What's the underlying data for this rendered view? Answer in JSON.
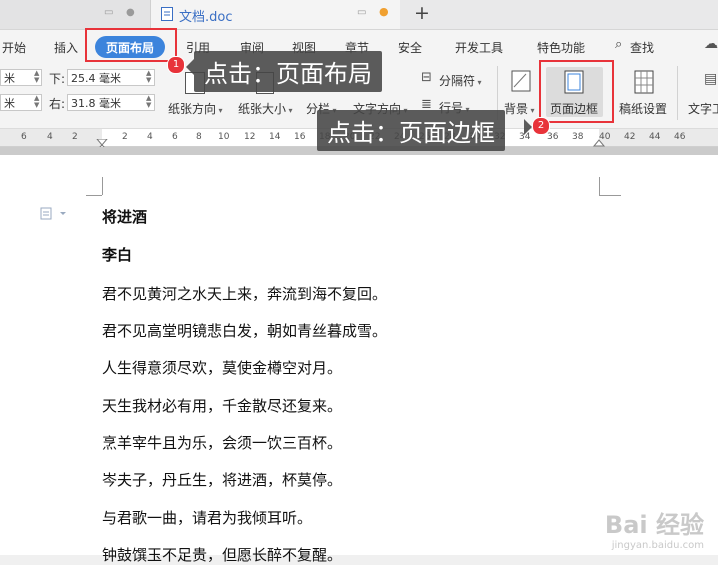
{
  "tabs": {
    "doc_title": "文档.doc",
    "new_tab": "+"
  },
  "menu": {
    "items": [
      "开始",
      "插入",
      "页面布局",
      "引用",
      "审阅",
      "视图",
      "章节",
      "安全",
      "开发工具",
      "特色功能"
    ],
    "search": "查找"
  },
  "ribbon": {
    "margin_bottom_label": "下:",
    "margin_bottom_value": "25.4 毫米",
    "margin_right_label": "右:",
    "margin_right_value": "31.8 毫米",
    "left_field_1": "米",
    "left_field_2": "米",
    "orientation": "纸张方向",
    "size": "纸张大小",
    "columns": "分栏",
    "text_direction": "文字方向",
    "separator": "分隔符",
    "line_number": "行号",
    "background": "背景",
    "page_border": "页面边框",
    "manuscript": "稿纸设置",
    "text_tool": "文字工"
  },
  "ruler": {
    "ticks": [
      "6",
      "4",
      "2",
      "2",
      "4",
      "6",
      "8",
      "10",
      "12",
      "14",
      "16",
      "18",
      "20",
      "22",
      "24",
      "26",
      "28",
      "30",
      "32",
      "34",
      "36",
      "38",
      "40",
      "42",
      "44",
      "46"
    ]
  },
  "document": {
    "title": "将进酒",
    "author": "李白",
    "lines": [
      "君不见黄河之水天上来，奔流到海不复回。",
      "君不见高堂明镜悲白发，朝如青丝暮成雪。",
      "人生得意须尽欢，莫使金樽空对月。",
      "天生我材必有用，千金散尽还复来。",
      "烹羊宰牛且为乐，会须一饮三百杯。",
      "岑夫子，丹丘生，将进酒，杯莫停。",
      "与君歌一曲，请君为我倾耳听。",
      "钟鼓馔玉不足贵，但愿长醉不复醒。"
    ]
  },
  "annotations": {
    "step1_badge": "1",
    "step1_text": "点击：页面布局",
    "step2_badge": "2",
    "step2_text": "点击：页面边框"
  },
  "watermark": {
    "brand": "Bai 经验",
    "url": "jingyan.baidu.com"
  },
  "colors": {
    "accent": "#3c84dc",
    "annotation_red": "#e8333a",
    "link_blue": "#3a6fc4"
  }
}
